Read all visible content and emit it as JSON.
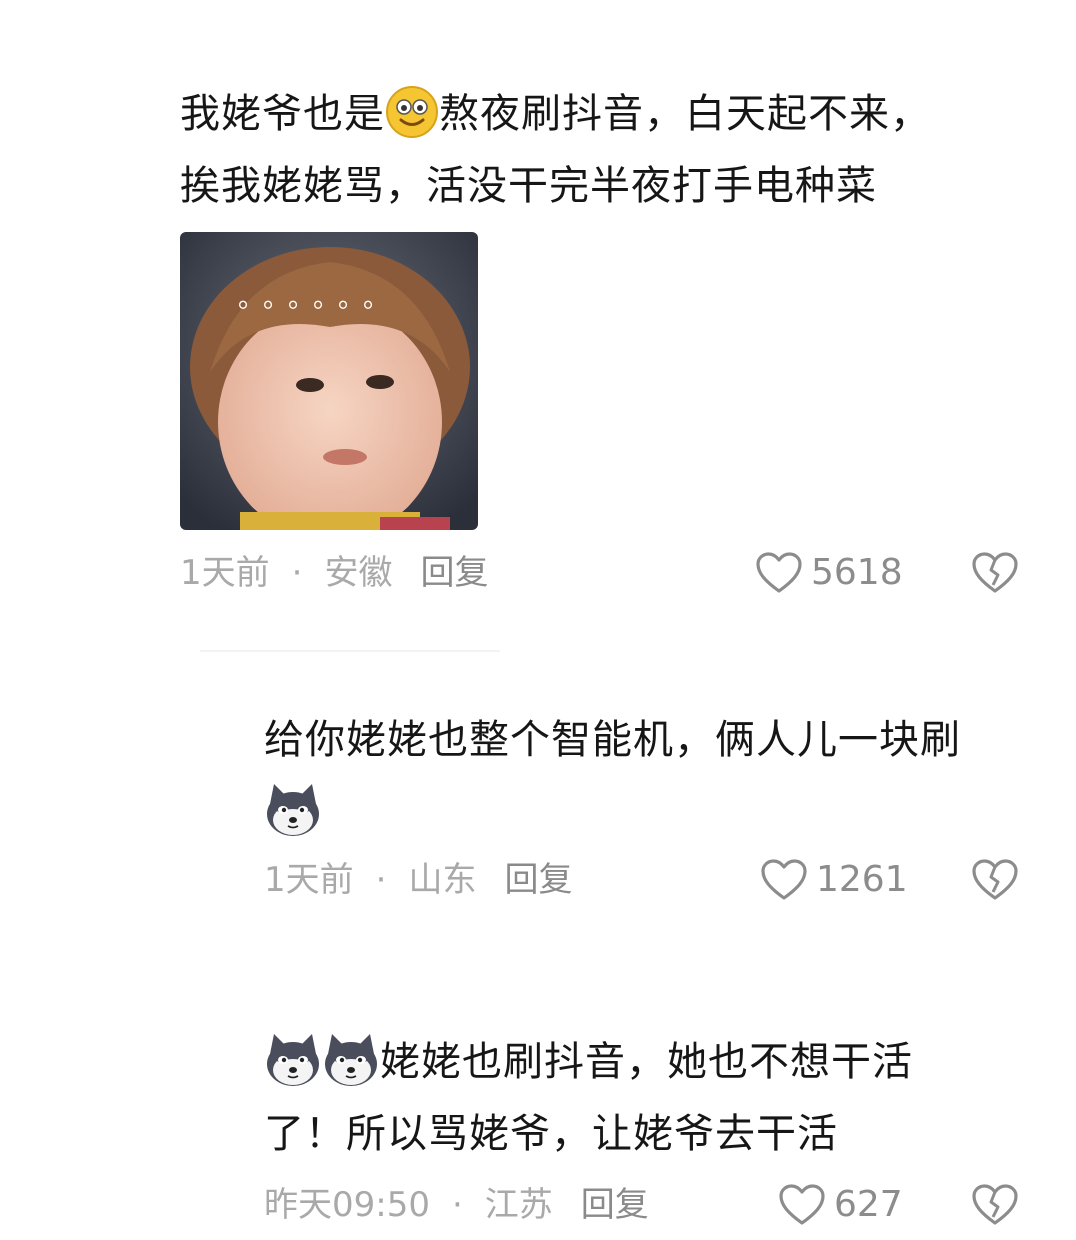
{
  "comments": [
    {
      "text_before_emoji": "我姥爷也是",
      "emoji": "smile-emoji",
      "text_after_emoji": "熬夜刷抖音，白天起不来，",
      "line2": "挨我姥姥骂，活没干完半夜打手电种菜",
      "image_overlay": "。。。。。。",
      "time": "1天前",
      "location": "安徽",
      "reply_label": "回复",
      "likes": "5618"
    },
    {
      "line1": "给你姥姥也整个智能机，俩人儿一块刷",
      "emoji": "husky-emoji",
      "time": "1天前",
      "location": "山东",
      "reply_label": "回复",
      "likes": "1261"
    },
    {
      "emoji": "husky-emoji",
      "line1_text": "姥姥也刷抖音，她也不想干活",
      "line2": "了！所以骂姥爷，让姥爷去干活",
      "time": "昨天09:50",
      "location": "江苏",
      "reply_label": "回复",
      "likes": "627"
    }
  ],
  "separator": "·",
  "colors": {
    "text": "#161616",
    "meta": "#a9a9a9",
    "reply": "#8a8a8a",
    "icon": "#8c8c8c"
  }
}
